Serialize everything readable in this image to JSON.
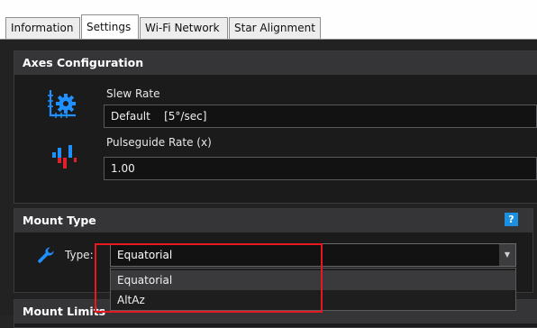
{
  "tabs": [
    {
      "label": "Information",
      "active": false
    },
    {
      "label": "Settings",
      "active": true
    },
    {
      "label": "Wi-Fi Network",
      "active": false
    },
    {
      "label": "Star Alignment",
      "active": false
    }
  ],
  "axes_config": {
    "title": "Axes Configuration",
    "slew_rate": {
      "label": "Slew Rate",
      "value": "Default    [5°/sec]"
    },
    "pulseguide_rate": {
      "label": "Pulseguide Rate (x)",
      "value": "1.00"
    }
  },
  "mount_type": {
    "title": "Mount Type",
    "help": "?",
    "type_label": "Type:",
    "selected": "Equatorial",
    "options": [
      "Equatorial",
      "AltAz"
    ]
  },
  "mount_limits": {
    "title": "Mount Limits"
  },
  "colors": {
    "accent": "#1d8fe0",
    "highlight": "#e8181f"
  }
}
